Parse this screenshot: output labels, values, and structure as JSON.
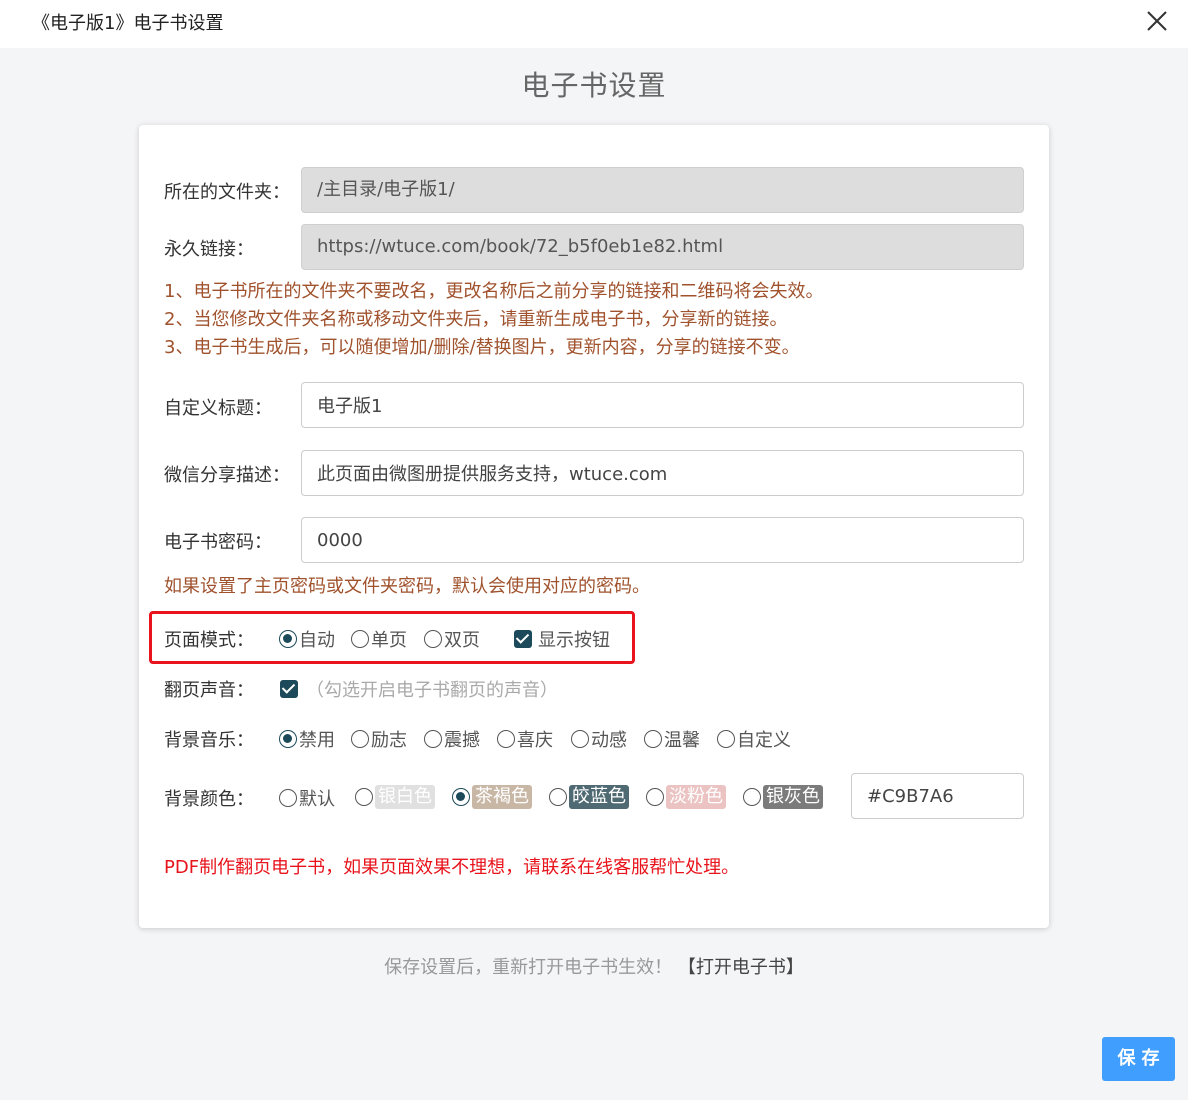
{
  "window": {
    "title": "《电子版1》电子书设置"
  },
  "heading": "电子书设置",
  "folder": {
    "label": "所在的文件夹：",
    "value": "/主目录/电子版1/"
  },
  "permalink": {
    "label": "永久链接：",
    "value": "https://wtuce.com/book/72_b5f0eb1e82.html"
  },
  "notes": [
    "1、电子书所在的文件夹不要改名，更改名称后之前分享的链接和二维码将会失效。",
    "2、当您修改文件夹名称或移动文件夹后，请重新生成电子书，分享新的链接。",
    "3、电子书生成后，可以随便增加/删除/替换图片，更新内容，分享的链接不变。"
  ],
  "custom_title": {
    "label": "自定义标题：",
    "value": "电子版1"
  },
  "wechat_desc": {
    "label": "微信分享描述：",
    "value": "此页面由微图册提供服务支持，wtuce.com"
  },
  "password": {
    "label": "电子书密码：",
    "value": "0000",
    "note": "如果设置了主页密码或文件夹密码，默认会使用对应的密码。"
  },
  "page_mode": {
    "label": "页面模式：",
    "options": [
      "自动",
      "单页",
      "双页"
    ],
    "selected": "自动",
    "show_buttons_label": "显示按钮",
    "show_buttons_checked": true
  },
  "flip_sound": {
    "label": "翻页声音：",
    "checked": true,
    "hint": "（勾选开启电子书翻页的声音）"
  },
  "bg_music": {
    "label": "背景音乐：",
    "options": [
      "禁用",
      "励志",
      "震撼",
      "喜庆",
      "动感",
      "温馨",
      "自定义"
    ],
    "selected": "禁用"
  },
  "bg_color": {
    "label": "背景颜色：",
    "options": [
      {
        "label": "默认",
        "color": ""
      },
      {
        "label": "银白色",
        "color": "#e0e0e0"
      },
      {
        "label": "茶褐色",
        "color": "#c9b7a6"
      },
      {
        "label": "皎蓝色",
        "color": "#4f6a73"
      },
      {
        "label": "淡粉色",
        "color": "#ebc3c3"
      },
      {
        "label": "银灰色",
        "color": "#7b7b7b"
      }
    ],
    "selected": "茶褐色",
    "hex_value": "#C9B7A6"
  },
  "pdf_warning": "PDF制作翻页电子书，如果页面效果不理想，请联系在线客服帮忙处理。",
  "footer": {
    "tip": "保存设置后，重新打开电子书生效！",
    "open_link": "【打开电子书】"
  },
  "save_button": "保存"
}
